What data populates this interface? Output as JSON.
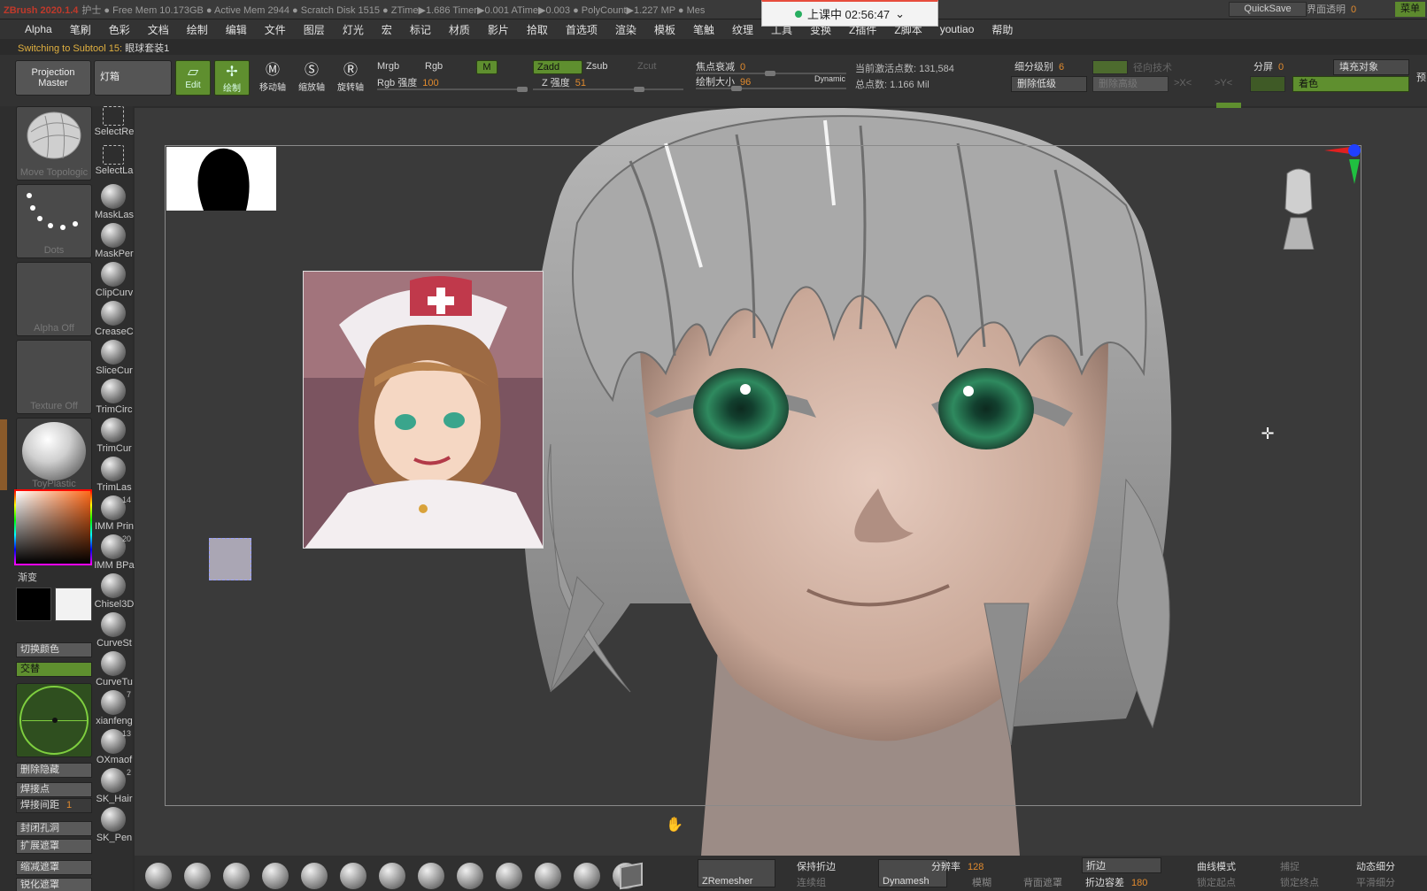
{
  "titlebar": {
    "app_title": "ZBrush 2020.1.4",
    "stats": "护士 ● Free Mem 10.173GB ● Active Mem 2944 ● Scratch Disk 1515 ● ZTime▶1.686 Timer▶0.001 ATime▶0.003 ● PolyCount▶1.227 MP ● Mes",
    "live_badge": "上课中 02:56:47",
    "quicksave": "QuickSave",
    "transparency_label": "界面透明",
    "transparency_value": "0",
    "right_button": "菜单"
  },
  "menubar": [
    "Alpha",
    "笔刷",
    "色彩",
    "文档",
    "绘制",
    "编辑",
    "文件",
    "图层",
    "灯光",
    "宏",
    "标记",
    "材质",
    "影片",
    "拾取",
    "首选项",
    "渲染",
    "模板",
    "笔触",
    "纹理",
    "工具",
    "变换",
    "Z插件",
    "Z脚本",
    "youtiao",
    "帮助"
  ],
  "status": {
    "prefix": "Switching to Subtool 15: ",
    "name": "眼球套装1"
  },
  "toolbar": {
    "projection_master": "Projection Master",
    "lightbox": "灯箱",
    "edit": "Edit",
    "draw": "绘制",
    "move": "移动轴",
    "scale": "缩放轴",
    "rotate": "旋转轴",
    "mrgb": "Mrgb",
    "rgb": "Rgb",
    "m": "M",
    "rgb_intensity_label": "Rgb 强度",
    "rgb_intensity_value": "100",
    "zadd": "Zadd",
    "zsub": "Zsub",
    "zcut": "Zcut",
    "z_intensity_label": "Z 强度",
    "z_intensity_value": "51",
    "focal_label": "焦点衰减",
    "focal_value": "0",
    "draw_size_label": "绘制大小",
    "draw_size_value": "96",
    "dynamic": "Dynamic",
    "active_points": "当前激活点数: 131,584",
    "total_points": "总点数: 1.166 Mil",
    "subdiv_label": "细分级别",
    "subdiv_value": "6",
    "delete_lower": "删除低级",
    "delete_higher": "删除高级",
    "radial_tech": "径向技术",
    "split_label": "分屏",
    "split_value": "0",
    "fill_object": "填充对象",
    "color_button": "着色",
    "preview": "预"
  },
  "left": {
    "thumb1": "Move Topologic",
    "thumb2": "Dots",
    "thumb3": "Alpha Off",
    "thumb4": "Texture Off",
    "thumb5": "ToyPlastic",
    "gradient": "渐变",
    "switch_color": "切换颜色",
    "alternate": "交替",
    "delete_hidden": "删除隐藏",
    "weld_points": "焊接点",
    "weld_dist_label": "焊接间距",
    "weld_dist_value": "1",
    "close_holes": "封闭孔洞",
    "grow_mask": "扩展遮罩",
    "shrink_mask": "缩减遮罩",
    "sharpen_mask": "锐化遮罩"
  },
  "brushes": [
    {
      "name": "SelectRe",
      "badge": ""
    },
    {
      "name": "SelectLa",
      "badge": ""
    },
    {
      "name": "MaskLas",
      "badge": ""
    },
    {
      "name": "MaskPer",
      "badge": ""
    },
    {
      "name": "ClipCurv",
      "badge": ""
    },
    {
      "name": "CreaseC",
      "badge": ""
    },
    {
      "name": "SliceCur",
      "badge": ""
    },
    {
      "name": "TrimCirc",
      "badge": ""
    },
    {
      "name": "TrimCur",
      "badge": ""
    },
    {
      "name": "TrimLas",
      "badge": ""
    },
    {
      "name": "IMM Prin",
      "badge": "14"
    },
    {
      "name": "IMM BPa",
      "badge": "20"
    },
    {
      "name": "Chisel3D",
      "badge": ""
    },
    {
      "name": "CurveSt",
      "badge": ""
    },
    {
      "name": "CurveTu",
      "badge": ""
    },
    {
      "name": "xianfeng",
      "badge": "7"
    },
    {
      "name": "OXmaof",
      "badge": "13"
    },
    {
      "name": "SK_Hair",
      "badge": "2"
    },
    {
      "name": "SK_Pen",
      "badge": ""
    }
  ],
  "bottom": {
    "zremesher": "ZRemesher",
    "keep_creases": "保持折边",
    "dynamesh": "Dynamesh",
    "resolution_label": "分辨率",
    "resolution_value": "128",
    "crease": "折边",
    "curve_mode": "曲线模式",
    "capture": "捕捉",
    "dyn_subdiv": "动态细分",
    "crease_tol_label": "折边容差",
    "crease_tol_value": "180",
    "blur_label": "模糊",
    "back_mask": "背面遮罩",
    "lock_start": "锁定起点",
    "lock_end": "锁定终点",
    "smooth_subdiv": "平滑细分",
    "polygroups": "连续组"
  }
}
